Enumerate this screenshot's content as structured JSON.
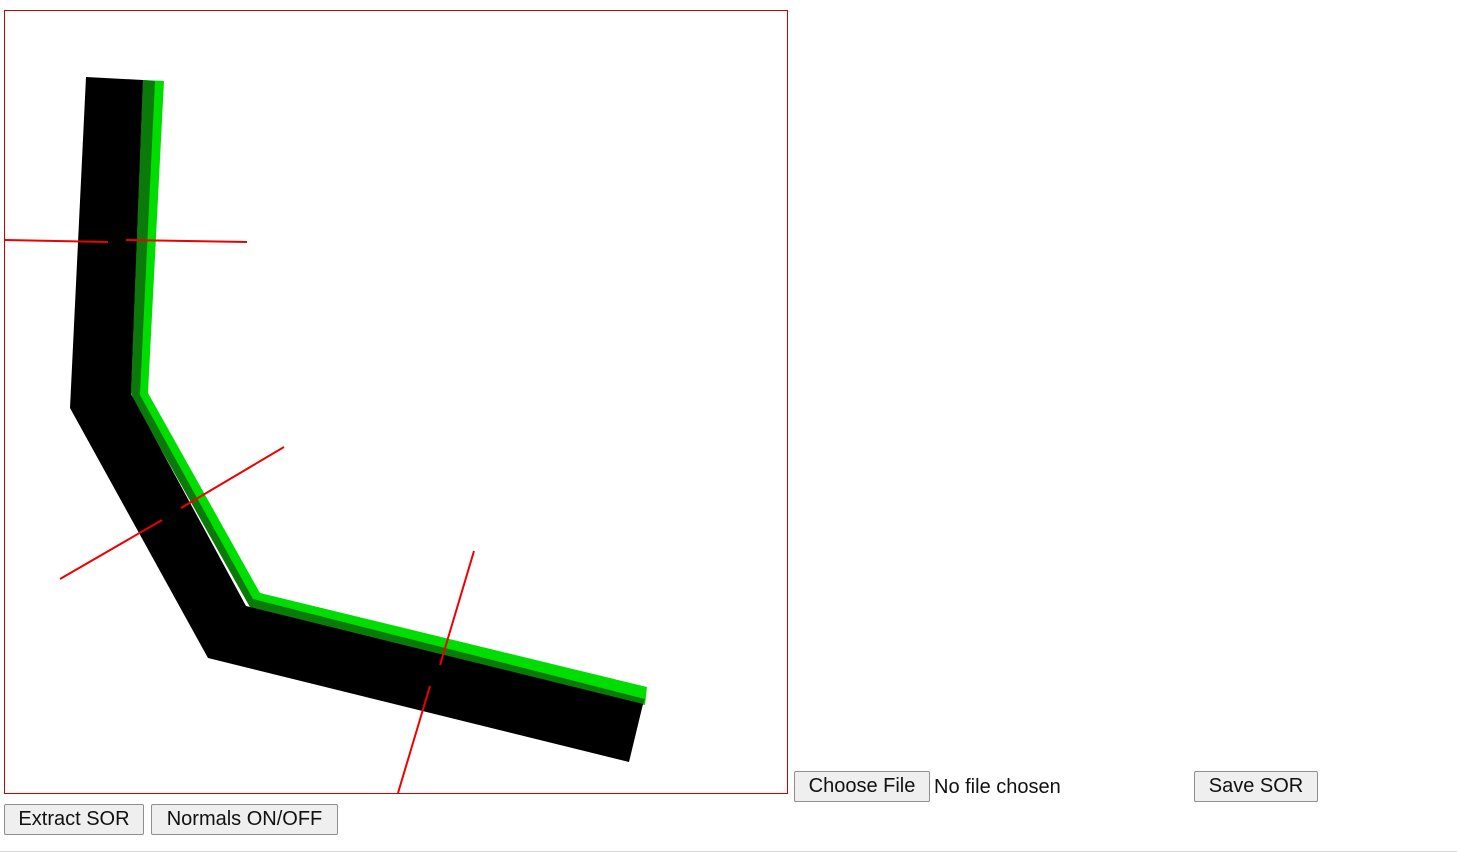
{
  "file_input": {
    "button_label": "Choose File",
    "status_text": "No file chosen"
  },
  "toolbar": {
    "save_label": "Save SOR",
    "extract_label": "Extract SOR",
    "normals_label": "Normals ON/OFF"
  },
  "canvas": {
    "border_color": "#d00000",
    "polyline_color": "#000000",
    "edge_color": "#00dd00",
    "normal_color": "#ee0000",
    "normals_visible": true,
    "polyline_vertex_count": 4,
    "normal_count": 3
  }
}
